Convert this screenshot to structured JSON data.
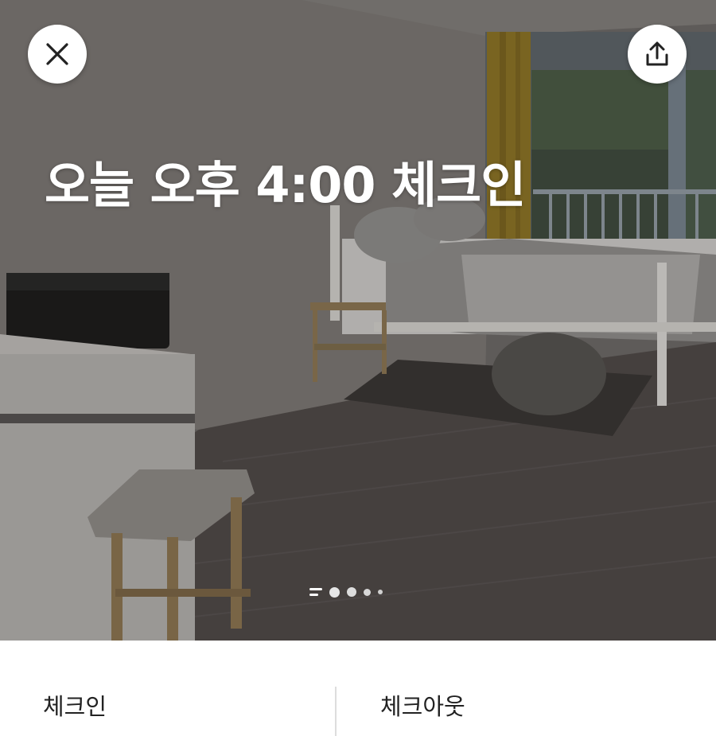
{
  "listing": {
    "headline": "오늘 오후 4:00 체크인",
    "photo_count": 5,
    "current_photo": 1
  },
  "header": {
    "close_icon": "close-icon",
    "share_icon": "share-icon"
  },
  "dates": {
    "checkin_label": "체크인",
    "checkout_label": "체크아웃"
  },
  "colors": {
    "overlay_text": "#ffffff",
    "label_text": "#222222",
    "divider": "#dddddd"
  }
}
